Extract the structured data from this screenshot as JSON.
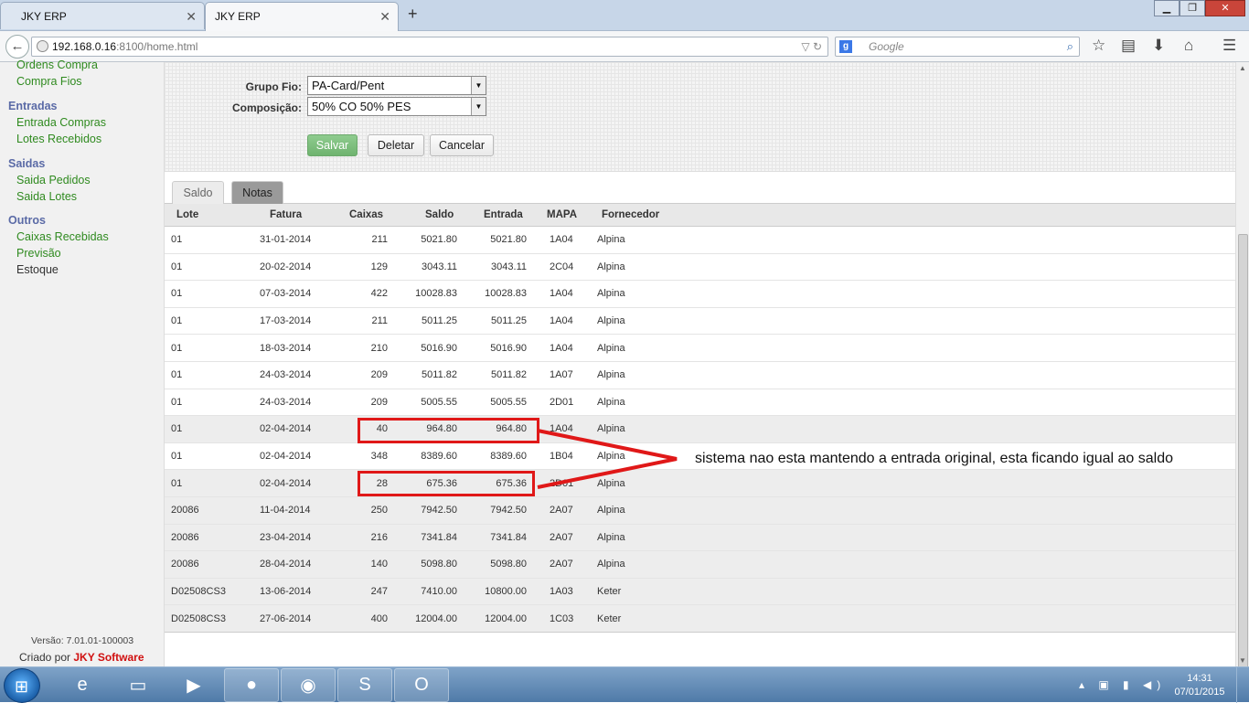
{
  "browser": {
    "tabs": [
      {
        "label": "JKY ERP"
      },
      {
        "label": "JKY ERP"
      }
    ],
    "url_host": "192.168.0.16",
    "url_rest": ":8100/home.html",
    "search_placeholder": "Google",
    "new_tab": "+"
  },
  "sidebar": {
    "groups": [
      {
        "heading": "",
        "items": [
          "Ordens Compra",
          "Compra Fios"
        ]
      },
      {
        "heading": "Entradas",
        "items": [
          "Entrada Compras",
          "Lotes Recebidos"
        ]
      },
      {
        "heading": "Saidas",
        "items": [
          "Saida Pedidos",
          "Saida Lotes"
        ]
      },
      {
        "heading": "Outros",
        "items": [
          "Caixas Recebidas",
          "Previsão",
          "Estoque"
        ]
      }
    ],
    "version": "Versão: 7.01.01-100003",
    "criado_prefix": "Criado por ",
    "criado_brand": "JKY Software"
  },
  "form": {
    "grupo_fio_label": "Grupo Fio:",
    "grupo_fio_value": "PA-Card/Pent",
    "composicao_label": "Composição:",
    "composicao_value": "50% CO 50% PES",
    "save_label": "Salvar",
    "delete_label": "Deletar",
    "cancel_label": "Cancelar"
  },
  "tabs": [
    {
      "label": "Saldo"
    },
    {
      "label": "Notas"
    }
  ],
  "table": {
    "headers": [
      "Lote",
      "Fatura",
      "Caixas",
      "Saldo",
      "Entrada",
      "MAPA",
      "Fornecedor"
    ],
    "rows": [
      [
        "01",
        "31-01-2014",
        "211",
        "5021.80",
        "5021.80",
        "1A04",
        "Alpina"
      ],
      [
        "01",
        "20-02-2014",
        "129",
        "3043.11",
        "3043.11",
        "2C04",
        "Alpina"
      ],
      [
        "01",
        "07-03-2014",
        "422",
        "10028.83",
        "10028.83",
        "1A04",
        "Alpina"
      ],
      [
        "01",
        "17-03-2014",
        "211",
        "5011.25",
        "5011.25",
        "1A04",
        "Alpina"
      ],
      [
        "01",
        "18-03-2014",
        "210",
        "5016.90",
        "5016.90",
        "1A04",
        "Alpina"
      ],
      [
        "01",
        "24-03-2014",
        "209",
        "5011.82",
        "5011.82",
        "1A07",
        "Alpina"
      ],
      [
        "01",
        "24-03-2014",
        "209",
        "5005.55",
        "5005.55",
        "2D01",
        "Alpina"
      ],
      [
        "01",
        "02-04-2014",
        "40",
        "964.80",
        "964.80",
        "1A04",
        "Alpina"
      ],
      [
        "01",
        "02-04-2014",
        "348",
        "8389.60",
        "8389.60",
        "1B04",
        "Alpina"
      ],
      [
        "01",
        "02-04-2014",
        "28",
        "675.36",
        "675.36",
        "2D01",
        "Alpina"
      ],
      [
        "20086",
        "11-04-2014",
        "250",
        "7942.50",
        "7942.50",
        "2A07",
        "Alpina"
      ],
      [
        "20086",
        "23-04-2014",
        "216",
        "7341.84",
        "7341.84",
        "2A07",
        "Alpina"
      ],
      [
        "20086",
        "28-04-2014",
        "140",
        "5098.80",
        "5098.80",
        "2A07",
        "Alpina"
      ],
      [
        "D02508CS3",
        "13-06-2014",
        "247",
        "7410.00",
        "10800.00",
        "1A03",
        "Keter"
      ],
      [
        "D02508CS3",
        "27-06-2014",
        "400",
        "12004.00",
        "12004.00",
        "1C03",
        "Keter"
      ]
    ]
  },
  "annotation": {
    "text": "sistema nao esta mantendo a entrada original, esta ficando igual ao saldo",
    "color": "#e01818"
  },
  "taskbar": {
    "apps": [
      "internet-explorer-icon",
      "file-explorer-icon",
      "media-player-icon",
      "firefox-icon",
      "chrome-icon",
      "skype-icon",
      "outlook-icon"
    ],
    "time": "14:31",
    "date": "07/01/2015"
  }
}
